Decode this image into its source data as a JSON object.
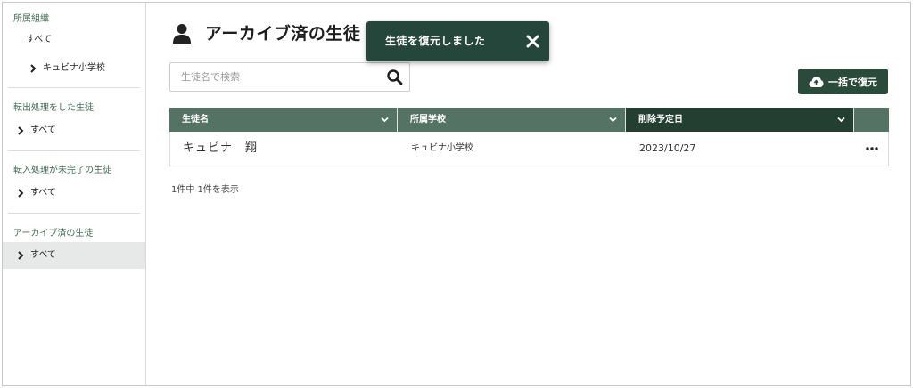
{
  "sidebar": {
    "sections": [
      {
        "heading": "所属組織",
        "items": [
          "すべて",
          "キュビナ小学校"
        ]
      },
      {
        "heading": "転出処理をした生徒",
        "items": [
          "すべて"
        ]
      },
      {
        "heading": "転入処理が未完了の生徒",
        "items": [
          "すべて"
        ]
      },
      {
        "heading": "アーカイブ済の生徒",
        "items": [
          "すべて"
        ]
      }
    ]
  },
  "header": {
    "title": "アーカイブ済の生徒",
    "icon": "user-icon"
  },
  "search": {
    "placeholder": "生徒名で検索",
    "value": ""
  },
  "toolbar": {
    "bulk_restore_label": "一括で復元"
  },
  "table": {
    "columns": [
      "生徒名",
      "所属学校",
      "削除予定日"
    ],
    "rows": [
      {
        "name": "キュビナ　翔",
        "school": "キュビナ小学校",
        "date": "2023/10/27"
      }
    ],
    "count_text": "1件中 1件を表示"
  },
  "toast": {
    "message": "生徒を復元しました"
  },
  "colors": {
    "accent_dark": "#223f31",
    "accent": "#557365",
    "button": "#2a4a3c",
    "toast": "#25463a",
    "heading_text": "#3f6b55"
  }
}
